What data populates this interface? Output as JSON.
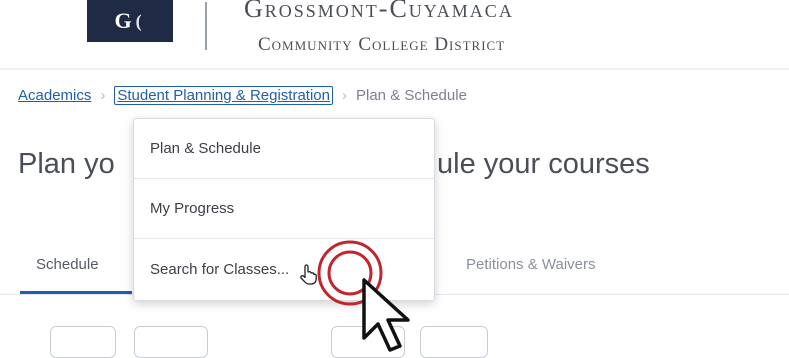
{
  "header": {
    "logo_letters": [
      "G",
      "("
    ],
    "org_name_line1": "Grossmont-Cuyamaca",
    "org_name_line2": "Community College District"
  },
  "breadcrumb": {
    "items": [
      "Academics",
      "Student Planning & Registration",
      "Plan & Schedule"
    ]
  },
  "page": {
    "title_left": "Plan yo",
    "title_right": "ule your courses"
  },
  "tabs": [
    {
      "label": "Schedule"
    },
    {
      "label": "Petitions & Waivers"
    }
  ],
  "dropdown": {
    "items": [
      "Plan & Schedule",
      "My Progress",
      "Search for Classes..."
    ]
  },
  "colors": {
    "link": "#1f5fae",
    "logo_bg": "#1f2a44",
    "click_ring": "#c0262d"
  },
  "icons": {
    "cursor": "arrow-pointer-icon",
    "hand": "hand-pointer-icon",
    "click": "click-ring-icon"
  }
}
